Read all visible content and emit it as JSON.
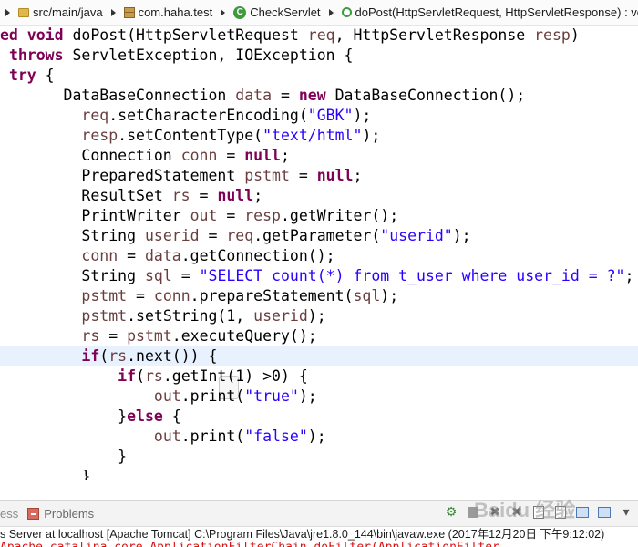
{
  "breadcrumb": {
    "items": [
      {
        "label": "src/main/java",
        "icon": "source-folder-icon"
      },
      {
        "label": "com.haha.test",
        "icon": "package-icon"
      },
      {
        "label": "CheckServlet",
        "icon": "class-icon",
        "glyph": "C"
      },
      {
        "label": "doPost(HttpServletRequest, HttpServletResponse) : void",
        "icon": "method-icon"
      }
    ]
  },
  "editor": {
    "lines": [
      [
        {
          "t": "ed void",
          "c": "kw"
        },
        {
          "t": " doPost(HttpServletRequest "
        },
        {
          "t": "req",
          "c": "var"
        },
        {
          "t": ", HttpServletResponse "
        },
        {
          "t": "resp",
          "c": "var"
        },
        {
          "t": ")"
        }
      ],
      [
        {
          "t": " "
        },
        {
          "t": "throws",
          "c": "kw"
        },
        {
          "t": " ServletException, IOException {"
        }
      ],
      [
        {
          "t": " "
        },
        {
          "t": "try",
          "c": "kw"
        },
        {
          "t": " {"
        }
      ],
      [
        {
          "t": "       DataBaseConnection "
        },
        {
          "t": "data",
          "c": "var"
        },
        {
          "t": " = "
        },
        {
          "t": "new",
          "c": "kw"
        },
        {
          "t": " DataBaseConnection();"
        }
      ],
      [
        {
          "t": "         "
        },
        {
          "t": "req",
          "c": "var"
        },
        {
          "t": ".setCharacterEncoding("
        },
        {
          "t": "\"GBK\"",
          "c": "str"
        },
        {
          "t": ");"
        }
      ],
      [
        {
          "t": "         "
        },
        {
          "t": "resp",
          "c": "var"
        },
        {
          "t": ".setContentType("
        },
        {
          "t": "\"text/html\"",
          "c": "str"
        },
        {
          "t": ");"
        }
      ],
      [
        {
          "t": "         Connection "
        },
        {
          "t": "conn",
          "c": "var"
        },
        {
          "t": " = "
        },
        {
          "t": "null",
          "c": "kw"
        },
        {
          "t": ";"
        }
      ],
      [
        {
          "t": "         PreparedStatement "
        },
        {
          "t": "pstmt",
          "c": "var"
        },
        {
          "t": " = "
        },
        {
          "t": "null",
          "c": "kw"
        },
        {
          "t": ";"
        }
      ],
      [
        {
          "t": "         ResultSet "
        },
        {
          "t": "rs",
          "c": "var"
        },
        {
          "t": " = "
        },
        {
          "t": "null",
          "c": "kw"
        },
        {
          "t": ";"
        }
      ],
      [
        {
          "t": "         PrintWriter "
        },
        {
          "t": "out",
          "c": "var"
        },
        {
          "t": " = "
        },
        {
          "t": "resp",
          "c": "var"
        },
        {
          "t": ".getWriter();"
        }
      ],
      [
        {
          "t": "         String "
        },
        {
          "t": "userid",
          "c": "var"
        },
        {
          "t": " = "
        },
        {
          "t": "req",
          "c": "var"
        },
        {
          "t": ".getParameter("
        },
        {
          "t": "\"userid\"",
          "c": "str"
        },
        {
          "t": ");"
        }
      ],
      [
        {
          "t": "         "
        },
        {
          "t": "conn",
          "c": "var"
        },
        {
          "t": " = "
        },
        {
          "t": "data",
          "c": "var"
        },
        {
          "t": ".getConnection();"
        }
      ],
      [
        {
          "t": "         String "
        },
        {
          "t": "sql",
          "c": "var"
        },
        {
          "t": " = "
        },
        {
          "t": "\"SELECT count(*) from t_user where user_id = ?\"",
          "c": "str"
        },
        {
          "t": ";"
        }
      ],
      [
        {
          "t": "         "
        },
        {
          "t": "pstmt",
          "c": "var"
        },
        {
          "t": " = "
        },
        {
          "t": "conn",
          "c": "var"
        },
        {
          "t": ".prepareStatement("
        },
        {
          "t": "sql",
          "c": "var"
        },
        {
          "t": ");"
        }
      ],
      [
        {
          "t": "         "
        },
        {
          "t": "pstmt",
          "c": "var"
        },
        {
          "t": ".setString(1, "
        },
        {
          "t": "userid",
          "c": "var"
        },
        {
          "t": ");"
        }
      ],
      [
        {
          "t": "         "
        },
        {
          "t": "rs",
          "c": "var"
        },
        {
          "t": " = "
        },
        {
          "t": "pstmt",
          "c": "var"
        },
        {
          "t": ".executeQuery();"
        }
      ],
      [
        {
          "t": "         "
        },
        {
          "t": "if",
          "c": "kw"
        },
        {
          "t": "("
        },
        {
          "t": "rs",
          "c": "var"
        },
        {
          "t": ".next()) {"
        }
      ],
      [
        {
          "t": "             "
        },
        {
          "t": "if",
          "c": "kw"
        },
        {
          "t": "("
        },
        {
          "t": "rs",
          "c": "var"
        },
        {
          "t": ".getInt(1) >0) {"
        }
      ],
      [
        {
          "t": "                 "
        },
        {
          "t": "out",
          "c": "var"
        },
        {
          "t": ".print("
        },
        {
          "t": "\"true\"",
          "c": "str"
        },
        {
          "t": ");"
        }
      ],
      [
        {
          "t": "             }"
        },
        {
          "t": "else",
          "c": "kw"
        },
        {
          "t": " {"
        }
      ],
      [
        {
          "t": "                 "
        },
        {
          "t": "out",
          "c": "var"
        },
        {
          "t": ".print("
        },
        {
          "t": "\"false\"",
          "c": "str"
        },
        {
          "t": ");"
        }
      ],
      [
        {
          "t": "             }"
        }
      ],
      [
        {
          "t": "         }"
        }
      ]
    ],
    "current_line": 16
  },
  "console": {
    "tab_fragment": "ess",
    "problems_tab": "Problems",
    "status": "s Server at localhost [Apache Tomcat] C:\\Program Files\\Java\\jre1.8.0_144\\bin\\javaw.exe (2017年12月20日 下午9:12:02)",
    "error_fragment": "Apache catalina core ApplicationFilterChain doFilter(ApplicationFilter"
  },
  "colors": {
    "keyword": "#7f0055",
    "string": "#2a00ff",
    "local_var": "#6a3e3e",
    "current_line": "#e8f2fe",
    "error": "#dd1111"
  },
  "watermark": "Baidu 经验"
}
